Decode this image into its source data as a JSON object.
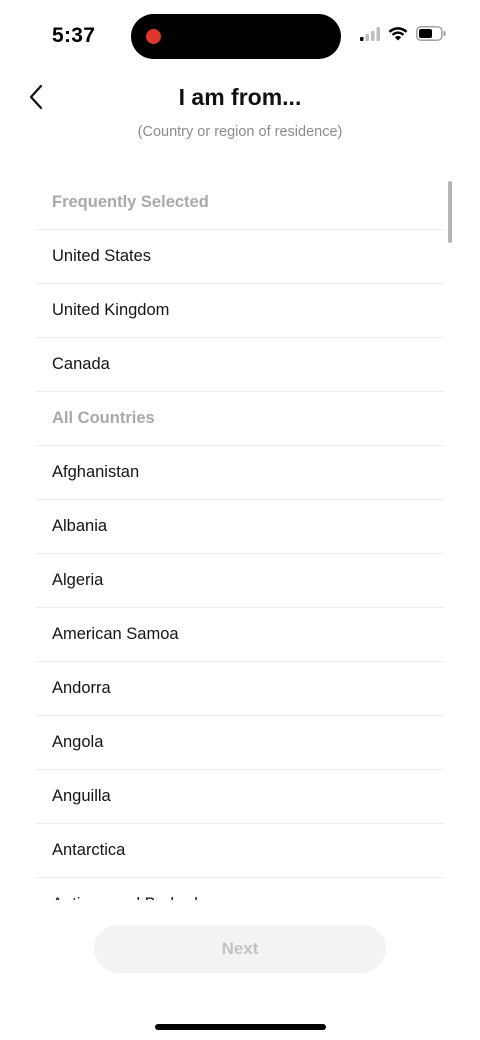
{
  "status_bar": {
    "time": "5:37",
    "icons": [
      "cellular-signal-icon",
      "wifi-icon",
      "battery-icon"
    ]
  },
  "header": {
    "back_icon": "chevron-left-icon",
    "title": "I am from...",
    "subtitle": "(Country or region of residence)"
  },
  "list": {
    "frequent_header": "Frequently Selected",
    "frequent": [
      "United States",
      "United Kingdom",
      "Canada"
    ],
    "all_header": "All Countries",
    "all": [
      "Afghanistan",
      "Albania",
      "Algeria",
      "American Samoa",
      "Andorra",
      "Angola",
      "Anguilla",
      "Antarctica",
      "Antigua and Barbuda"
    ]
  },
  "footer": {
    "next_label": "Next"
  },
  "colors": {
    "recording_dot": "#e0352b",
    "section_header_text": "#a9a9a9",
    "next_button_bg": "#f3f3f3",
    "next_button_text": "#c2c2c2"
  }
}
